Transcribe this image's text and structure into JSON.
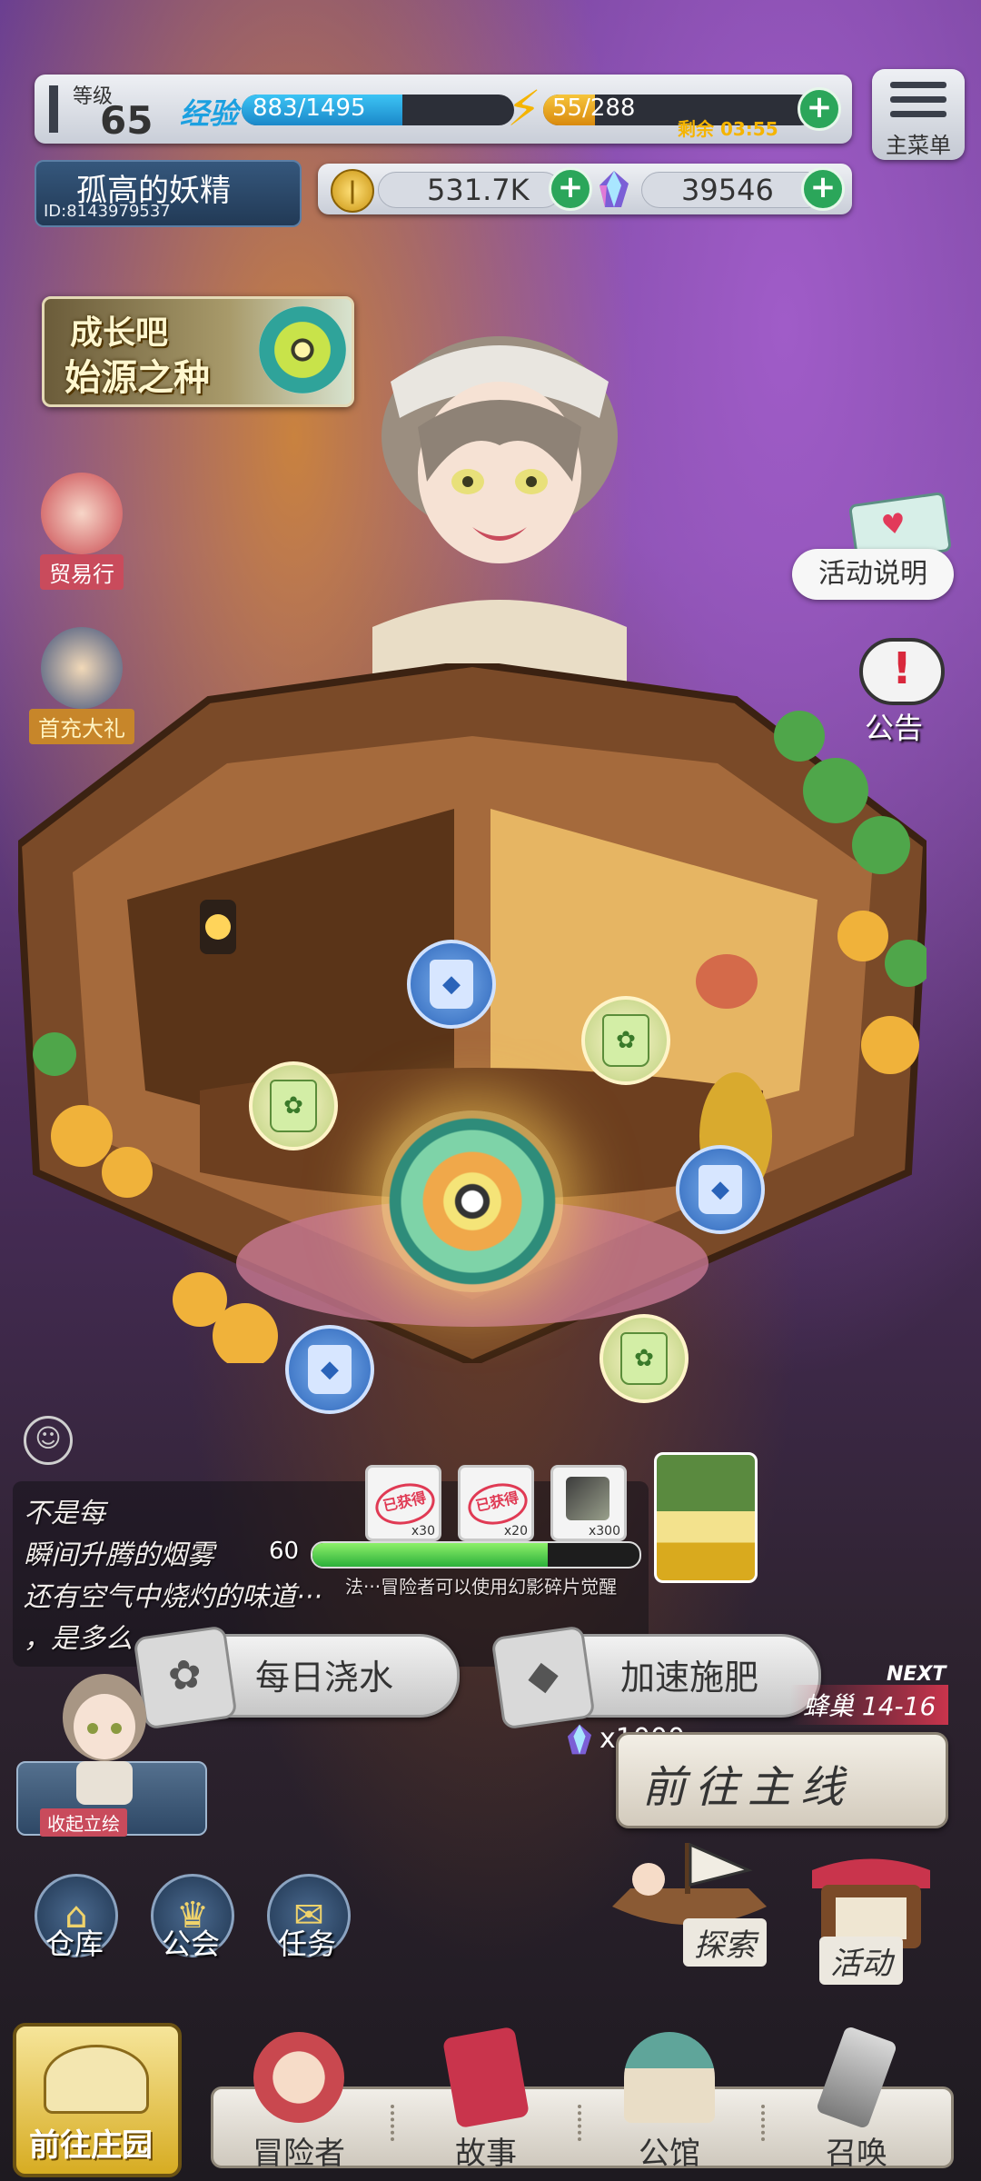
{
  "hud": {
    "level_label": "等级",
    "level": "65",
    "exp_label": "经验",
    "exp_text": "883/1495",
    "exp_fraction": 0.59,
    "energy_text": "55/288",
    "energy_fraction": 0.19,
    "energy_timer": "剩余 03:55",
    "menu_label": "主菜单",
    "player_name": "孤高的妖精",
    "player_id": "ID:8143979537",
    "gold": "531.7K",
    "gems": "39546",
    "plus_symbol": "+"
  },
  "banner": {
    "line1": "成长吧",
    "line2": "始源之种"
  },
  "side": {
    "trade": "贸易行",
    "first_recharge": "首充大礼",
    "event_info": "活动说明",
    "notice": "公告"
  },
  "story": {
    "lines": [
      "不是每",
      "瞬间升腾的烟雾",
      "还有空气中烧灼的味道···",
      "，是多么"
    ]
  },
  "growth": {
    "level": "60",
    "progress_fraction": 0.72,
    "hint": "法···冒险者可以使用幻影碎片觉醒",
    "rewards": [
      {
        "stamp": "已获得",
        "count": "x30"
      },
      {
        "stamp": "已获得",
        "count": "x20"
      },
      {
        "stamp": "",
        "count": "x300"
      }
    ],
    "water_label": "每日浇水",
    "fertilize_label": "加速施肥",
    "fertilize_cost": "x1000"
  },
  "right": {
    "hive_label": "蜂巢 14-16",
    "next_label": "NEXT",
    "main_quest": "前往主线",
    "explore": "探索",
    "activity": "活动"
  },
  "left_bottom": {
    "collapse_label": "收起立绘",
    "warehouse": "仓库",
    "guild": "公会",
    "quest": "任务"
  },
  "nav": {
    "farm": "前往庄园",
    "adventurer": "冒险者",
    "story": "故事",
    "hall": "公馆",
    "summon": "召唤"
  },
  "colors": {
    "exp_bar": "#1ca0e0",
    "energy_bar": "#f5b400",
    "plus_button": "#2ba65a",
    "label_red": "#c94b5c"
  },
  "icons": {
    "energy": "lightning-bolt-icon",
    "gold": "gold-coin-icon",
    "gem": "crystal-gem-icon",
    "menu": "hamburger-icon",
    "notice": "exclamation-icon",
    "mail": "heart-letter-icon"
  }
}
